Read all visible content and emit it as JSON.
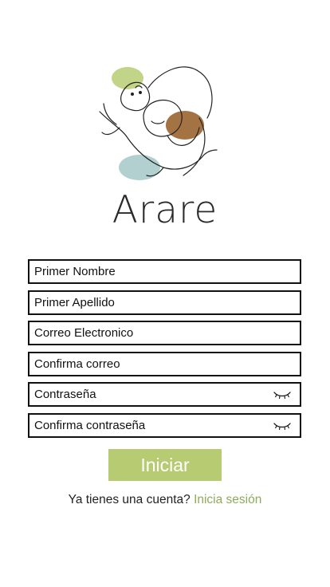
{
  "brand": {
    "name": "Arare",
    "accent_green": "#b7cc72",
    "link_green": "#8dab5b",
    "brown": "#9a6430",
    "teal": "#a9cbca"
  },
  "form": {
    "first_name_placeholder": "Primer Nombre",
    "last_name_placeholder": "Primer Apellido",
    "email_placeholder": "Correo Electronico",
    "confirm_email_placeholder": "Confirma correo",
    "password_placeholder": "Contraseña",
    "confirm_password_placeholder": "Confirma contraseña",
    "password_toggle_icon": "eye-closed-icon",
    "submit_label": "Iniciar"
  },
  "footer": {
    "prompt": "Ya tienes una cuenta?",
    "link_label": "Inicia sesión"
  }
}
